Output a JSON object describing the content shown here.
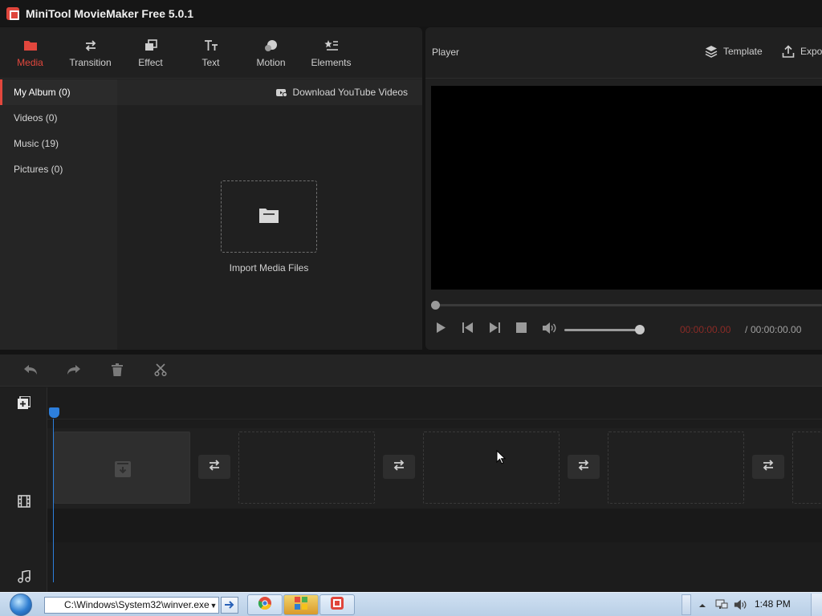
{
  "window": {
    "title": "MiniTool MovieMaker Free 5.0.1"
  },
  "toolbar": {
    "items": [
      {
        "label": "Media",
        "icon": "folder-icon"
      },
      {
        "label": "Transition",
        "icon": "swap-arrows-icon"
      },
      {
        "label": "Effect",
        "icon": "layers-icon"
      },
      {
        "label": "Text",
        "icon": "text-icon"
      },
      {
        "label": "Motion",
        "icon": "motion-icon"
      },
      {
        "label": "Elements",
        "icon": "elements-icon"
      }
    ],
    "active": "Media",
    "accent_color": "#e2473d"
  },
  "sidebar": {
    "items": [
      {
        "label": "My Album (0)"
      },
      {
        "label": "Videos (0)"
      },
      {
        "label": "Music (19)"
      },
      {
        "label": "Pictures (0)"
      }
    ]
  },
  "content": {
    "download_label": "Download YouTube Videos",
    "import_label": "Import Media Files"
  },
  "player": {
    "title": "Player",
    "template_label": "Template",
    "export_label": "Expo",
    "time_current": "00:00:00.00",
    "time_separator": "/",
    "time_total": "00:00:00.00",
    "time_current_color": "#8a2b26",
    "seek_fraction": 0,
    "volume_fraction": 1
  },
  "timeline": {
    "playhead_color": "#2d7fdc"
  },
  "taskbar": {
    "run_value": "C:\\Windows\\System32\\winver.exe",
    "clock": "1:48 PM"
  }
}
